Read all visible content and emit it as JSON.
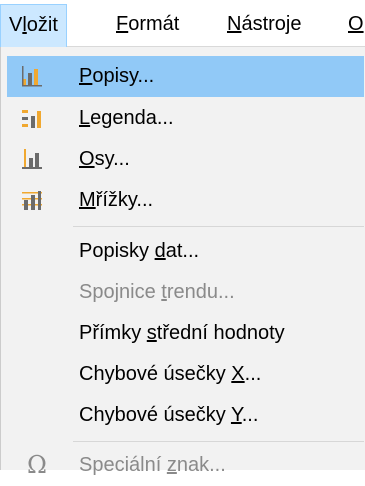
{
  "menubar": {
    "items": [
      {
        "label_pre": "V",
        "label_acc": "l",
        "label_post": "ožit"
      },
      {
        "label_pre": "",
        "label_acc": "F",
        "label_post": "ormát"
      },
      {
        "label_pre": "",
        "label_acc": "N",
        "label_post": "ástroje"
      },
      {
        "label_pre": "",
        "label_acc": "O",
        "label_post": ""
      }
    ]
  },
  "menu": {
    "items": [
      {
        "icon": "chart-titles-icon",
        "pre": "",
        "acc": "P",
        "post": "opisy..."
      },
      {
        "icon": "chart-legend-icon",
        "pre": "",
        "acc": "L",
        "post": "egenda..."
      },
      {
        "icon": "chart-axes-icon",
        "pre": "",
        "acc": "O",
        "post": "sy..."
      },
      {
        "icon": "chart-grids-icon",
        "pre": "",
        "acc": "M",
        "post": "řížky..."
      },
      {
        "pre": "Popisky ",
        "acc": "d",
        "post": "at..."
      },
      {
        "pre": "Spojnice ",
        "acc": "t",
        "post": "rendu..."
      },
      {
        "pre": "Přímky ",
        "acc": "s",
        "post": "třední hodnoty"
      },
      {
        "pre": "Chybové úsečky ",
        "acc": "X",
        "post": "..."
      },
      {
        "pre": "Chybové úsečky ",
        "acc": "Y",
        "post": "..."
      },
      {
        "icon": "omega-icon",
        "pre": "Speciální ",
        "acc": "z",
        "post": "nak..."
      }
    ]
  },
  "colors": {
    "highlight": "#91c9f7",
    "menu_bg": "#f2f2f2",
    "disabled_text": "#8a8a8a",
    "active_menubar_bg": "#cce8ff"
  }
}
